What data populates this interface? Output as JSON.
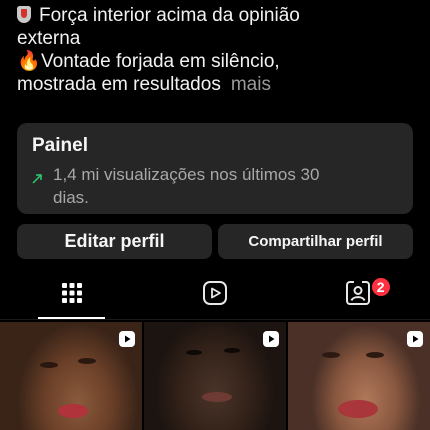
{
  "bio": {
    "line1_emoji": "shield-icon",
    "line1_text": "Força interior acima da opinião",
    "line2_text": "externa",
    "line3_emoji": "🔥",
    "line3_text": "Vontade forjada em silêncio,",
    "line4_text": "mostrada em resultados",
    "more_label": "mais"
  },
  "panel": {
    "title": "Painel",
    "stats_line1": "1,4 mi visualizações nos últimos 30",
    "stats_line2": "dias.",
    "trend_icon": "trend-up-icon"
  },
  "actions": {
    "edit_label": "Editar perfil",
    "share_label": "Compartilhar perfil"
  },
  "tabs": {
    "items": [
      {
        "name": "grid",
        "icon": "grid-icon",
        "active": true
      },
      {
        "name": "reels",
        "icon": "reels-icon",
        "active": false
      },
      {
        "name": "tagged",
        "icon": "tagged-icon",
        "active": false
      }
    ],
    "tagged_badge": "2",
    "badge_color": "#ff3040"
  },
  "grid": {
    "items": [
      {
        "type": "reel",
        "icon": "reels-icon"
      },
      {
        "type": "reel",
        "icon": "reels-icon"
      },
      {
        "type": "reel",
        "icon": "reels-icon"
      }
    ]
  },
  "colors": {
    "background": "#000000",
    "card": "#262626",
    "muted": "#a8a8a8",
    "trend": "#2ecc71"
  }
}
